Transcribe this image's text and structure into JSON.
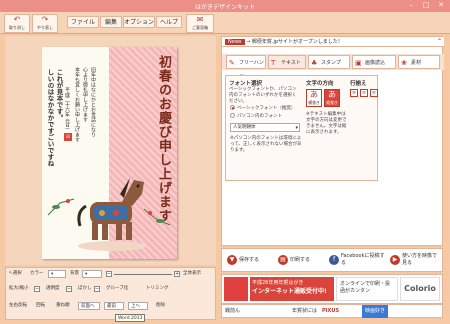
{
  "window": {
    "title": "はがきデザインキット"
  },
  "toolbar": {
    "undo": "取り消し",
    "redo": "やり直し",
    "menus": [
      "ファイル",
      "編集",
      "オプション",
      "ヘルプ"
    ],
    "feedback": "ご意見箱"
  },
  "card": {
    "greeting": "初春のお慶び申し上げます",
    "line1": "旧年中はなにかとお世話になり",
    "line2": "心より御礼申し上げます",
    "line3": "本年も宜しくお願い申し上げます",
    "date": "平成二十六年 元旦",
    "sample1": "これが見本です。",
    "sample2": "しいのはなかなかですごいですね"
  },
  "news": {
    "label": "News",
    "text": "→ 郵便年賀.jpサイトがオープンしました！"
  },
  "tabs": [
    "フリーハンド",
    "テキスト",
    "スタンプ",
    "画像読込",
    "素材"
  ],
  "font_panel": {
    "title": "フォント選択",
    "desc": "ベーシックフォントか、パソコン内のフォントのいずれかを選択ください。",
    "option1": "ベーシックフォント（推奨）",
    "option2": "パソコン内のフォント",
    "selected_font": "人気明朝体",
    "note": "※パソコン内のフォントは環境によって、正しく表示されない場合があります。"
  },
  "direction": {
    "title": "文字の方向",
    "horizontal": "横書き",
    "vertical": "縦書き",
    "note": "※テキスト編集中は文字の方向は変更できません。文字は縦に表示されます。"
  },
  "alignment": {
    "title": "行揃え"
  },
  "actions": {
    "save": "保存する",
    "print": "印刷する",
    "facebook": "Facebookに投稿する",
    "howto": "使い方を映像で見る"
  },
  "banners": {
    "b1": "平成26年用年賀はがき",
    "b2": "インターネット通販受付中!",
    "b3": "オンラインで印刷・投函がカンタン",
    "b4": "Colorio"
  },
  "bottom": {
    "left": "戦前ん",
    "center": "年賀状には",
    "pixus": "PIXUS",
    "mid": "映画好き"
  },
  "left_tools": {
    "select": "選択",
    "color": "カラー",
    "bg": "背景",
    "zoom_in": "拡大/縮小",
    "opacity": "透明度",
    "blur": "ぼかし",
    "grouping": "グループ化",
    "trimming": "トリミング",
    "flip": "左右反転",
    "rotate": "回転",
    "overlap": "重ね順",
    "bring_front": "前面へ",
    "front": "最前",
    "up": "上へ",
    "delete": "削除",
    "fit": "全体表示"
  },
  "tooltip": "Word 2013"
}
